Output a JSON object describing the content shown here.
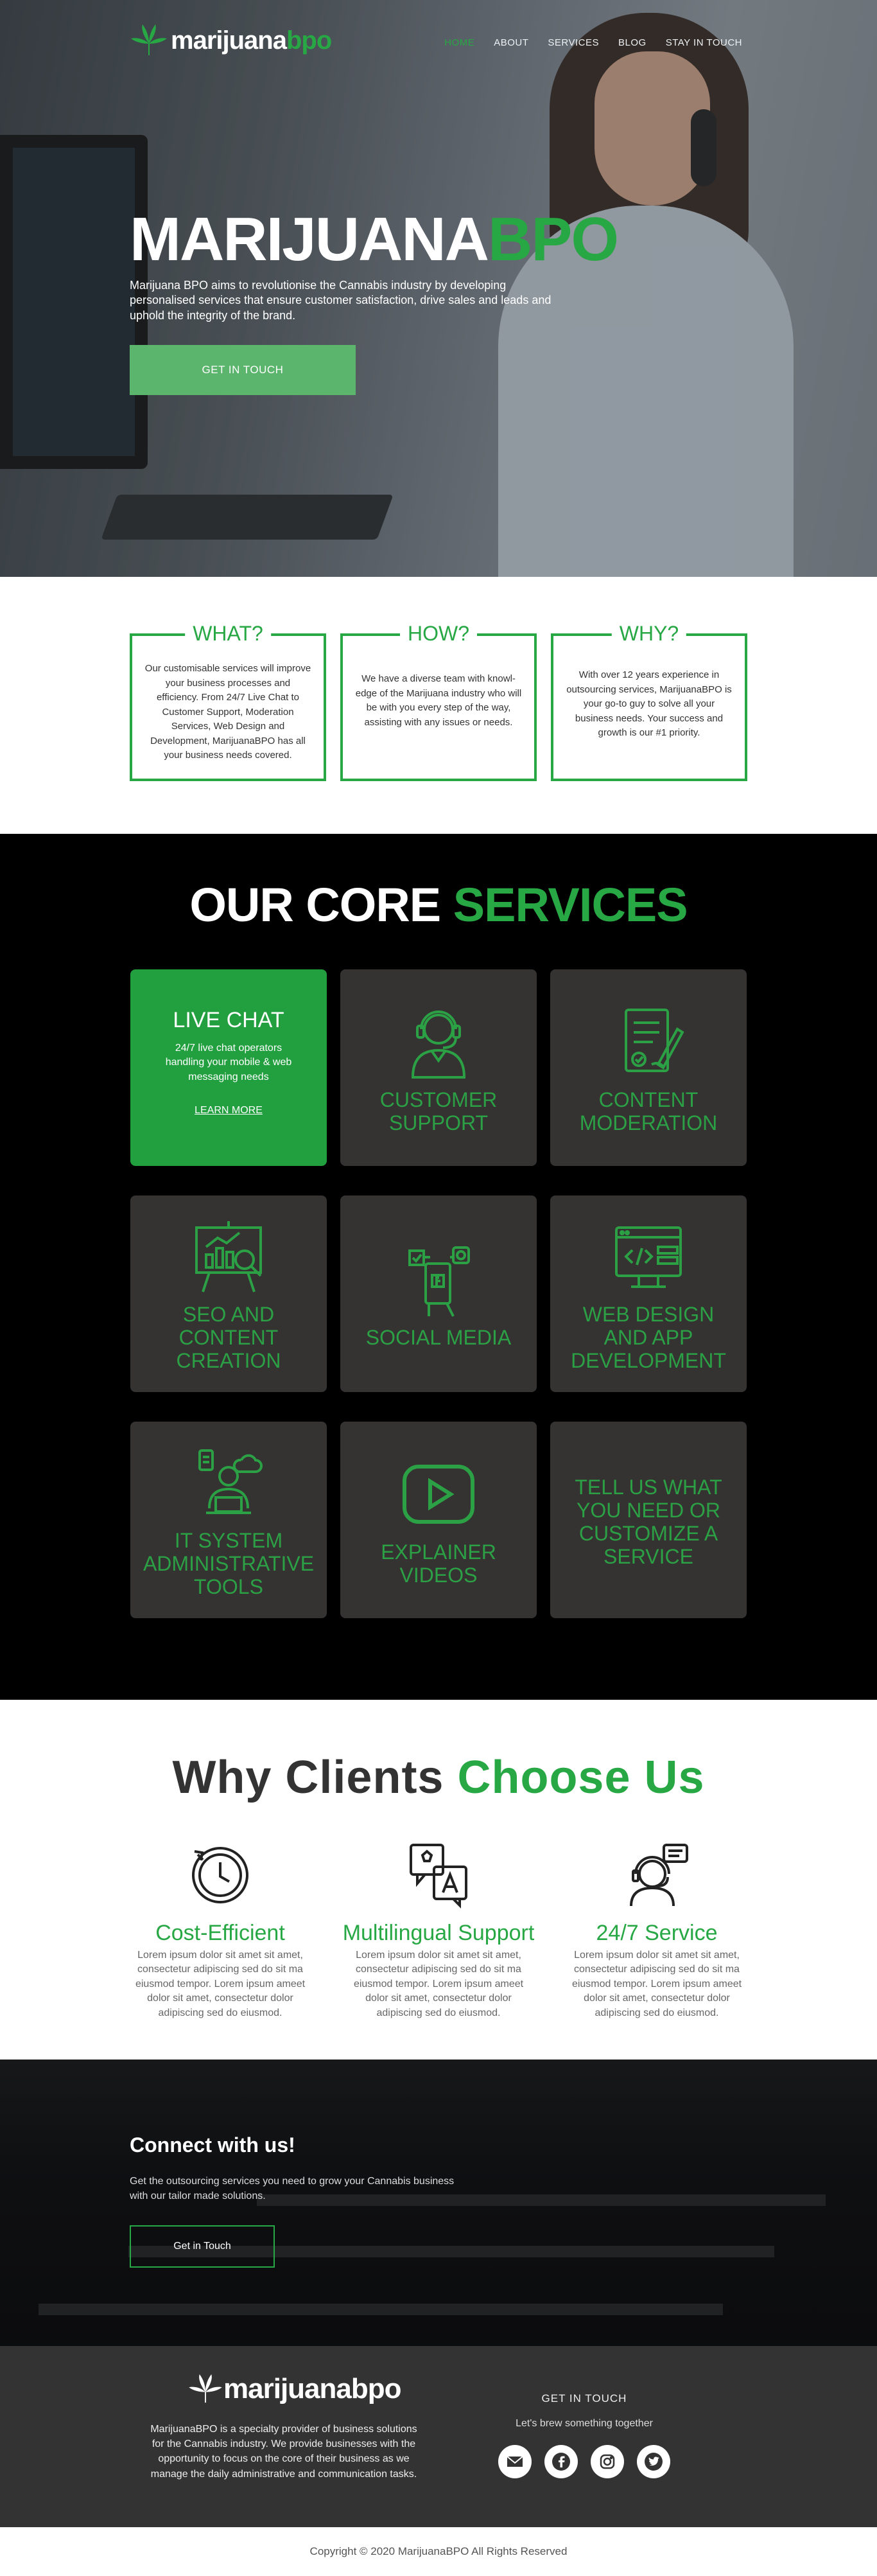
{
  "nav": {
    "logo_prefix": "marijuana",
    "logo_suffix": "bpo",
    "links": [
      "HOME",
      "ABOUT",
      "SERVICES",
      "BLOG",
      "STAY IN TOUCH"
    ]
  },
  "hero": {
    "title_white": "MARIJUANA",
    "title_green": "BPO",
    "description": "Marijuana BPO aims to revolutionise the Cannabis industry by developing personalised services that ensure customer satisfaction, drive sales and leads and uphold the integrity of the brand.",
    "button": "GET IN TOUCH"
  },
  "whw": [
    {
      "title": "WHAT?",
      "text": "Our customisable services will improve your business processes and efficiency. From 24/7 Live Chat to Customer Support, Moderation Services, Web Design and Development, MarijuanaBPO has all your business needs covered."
    },
    {
      "title": "HOW?",
      "text": "We have a diverse team with knowl-edge of the Marijuana industry who will be with you every step of the way, assisting with any issues or needs."
    },
    {
      "title": "WHY?",
      "text": "With over 12 years experience in outsourcing services, MarijuanaBPO is your go-to guy to solve all your business needs. Your success and growth is our #1 priority."
    }
  ],
  "core": {
    "heading_white": "OUR CORE",
    "heading_green": "SERVICES",
    "live_chat": {
      "title": "LIVE CHAT",
      "description": "24/7 live chat operators handling your mobile & web messaging needs",
      "link": "LEARN MORE"
    },
    "cards": [
      {
        "label": "CUSTOMER SUPPORT",
        "icon": "headset-agent-icon"
      },
      {
        "label": "CONTENT MODERATION",
        "icon": "document-check-icon"
      },
      {
        "label": "SEO AND CONTENT CREATION",
        "icon": "presentation-chart-icon"
      },
      {
        "label": "SOCIAL MEDIA",
        "icon": "social-media-phone-icon"
      },
      {
        "label": "WEB DESIGN AND APP DEVELOPMENT",
        "icon": "web-code-icon"
      },
      {
        "label": "IT SYSTEM ADMINISTRATIVE TOOLS",
        "icon": "it-admin-icon"
      },
      {
        "label": "EXPLAINER VIDEOS",
        "icon": "play-video-icon"
      },
      {
        "label": "TELL US WHAT YOU NEED OR CUSTOMIZE A SERVICE",
        "icon": ""
      }
    ],
    "accent_color": "#26a040"
  },
  "why": {
    "heading_dark": "Why Clients",
    "heading_green": "Choose Us",
    "items": [
      {
        "title": "Cost-Efficient",
        "icon": "clock-cost-icon",
        "text": "Lorem ipsum dolor sit amet sit amet, consectetur adipiscing sed do sit ma eiusmod tempor. Lorem ipsum ameet dolor sit amet, consectetur dolor adipiscing sed do eiusmod."
      },
      {
        "title": "Multilingual Support",
        "icon": "language-translate-icon",
        "text": "Lorem ipsum dolor sit amet sit amet, consectetur adipiscing sed do sit ma eiusmod tempor. Lorem ipsum ameet dolor sit amet, consectetur dolor adipiscing sed do eiusmod."
      },
      {
        "title": "24/7 Service",
        "icon": "support-agent-icon",
        "text": "Lorem ipsum dolor sit amet sit amet, consectetur adipiscing sed do sit ma eiusmod tempor. Lorem ipsum ameet dolor sit amet, consectetur dolor adipiscing sed do eiusmod."
      }
    ]
  },
  "connect": {
    "title": "Connect with us!",
    "text": "Get the outsourcing services you need to grow your Cannabis business with our tailor made solutions.",
    "button": "Get in Touch"
  },
  "footer": {
    "logo": "marijuanabpo",
    "about": "MarijuanaBPO is a specialty provider of business solutions for the Cannabis industry. We provide businesses with the opportunity to focus on the core of their business as we manage the daily administrative and communication tasks.",
    "contact_heading": "GET IN TOUCH",
    "contact_tagline": "Let's brew something together",
    "socials": [
      "email-icon",
      "facebook-icon",
      "instagram-icon",
      "twitter-icon"
    ],
    "copyright": "Copyright © 2020 MarijuanaBPO All Rights Reserved"
  }
}
